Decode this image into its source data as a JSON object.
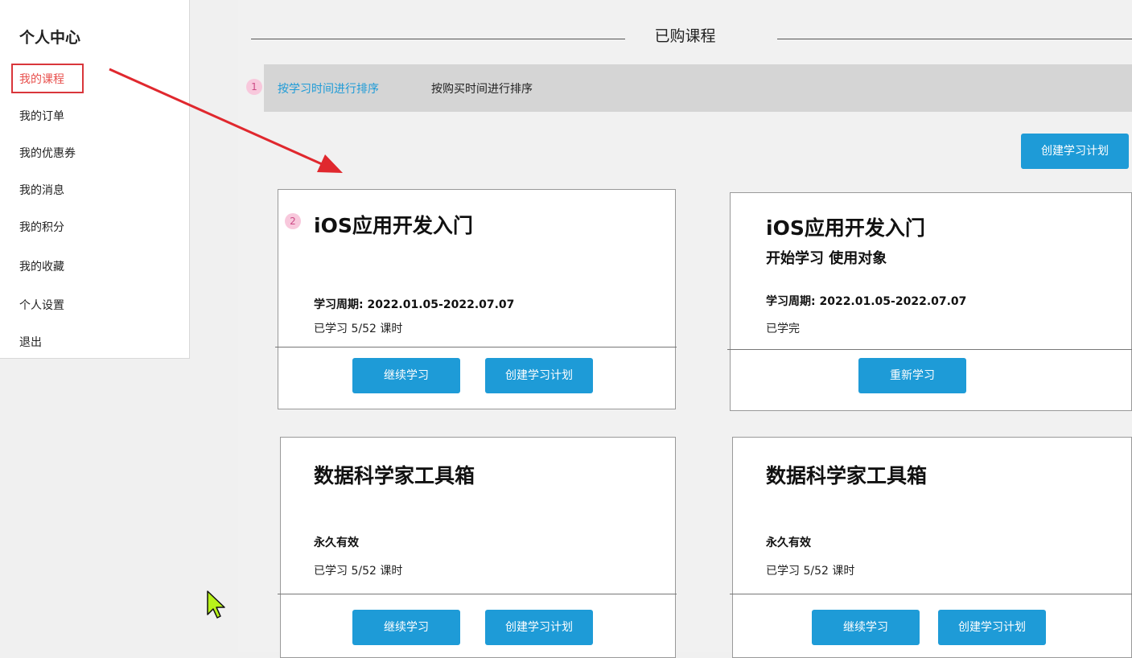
{
  "sidebar": {
    "title": "个人中心",
    "items": [
      {
        "label": "我的课程",
        "active": true
      },
      {
        "label": "我的订单"
      },
      {
        "label": "我的优惠券"
      },
      {
        "label": "我的消息"
      },
      {
        "label": "我的积分"
      },
      {
        "label": "我的收藏"
      },
      {
        "label": "个人设置"
      },
      {
        "label": "退出"
      }
    ]
  },
  "main": {
    "section_title": "已购课程",
    "sort": {
      "badge": "1",
      "by_study_time": "按学习时间进行排序",
      "by_purchase_time": "按购买时间进行排序"
    },
    "create_plan_button": "创建学习计划",
    "cards": [
      {
        "badge": "2",
        "title": "iOS应用开发入门",
        "subtitle": "",
        "period": "学习周期: 2022.01.05-2022.07.07",
        "progress": "已学习   5/52 课时",
        "buttons": [
          "继续学习",
          "创建学习计划"
        ]
      },
      {
        "title": "iOS应用开发入门",
        "subtitle": "开始学习  使用对象",
        "period": "学习周期: 2022.01.05-2022.07.07",
        "progress": "已学完",
        "buttons": [
          "重新学习"
        ]
      },
      {
        "title": "数据科学家工具箱",
        "period": "永久有效",
        "progress": "已学习   5/52 课时",
        "buttons": [
          "继续学习",
          "创建学习计划"
        ]
      },
      {
        "title": "数据科学家工具箱",
        "period": "永久有效",
        "progress": "已学习   5/52 课时",
        "buttons": [
          "继续学习",
          "创建学习计划"
        ]
      }
    ]
  },
  "colors": {
    "accent": "#1e9bd7",
    "active_nav": "#e8504d",
    "highlight_border": "#d9363b",
    "badge_bg": "#f8c8dc",
    "arrow": "#e0282e"
  }
}
